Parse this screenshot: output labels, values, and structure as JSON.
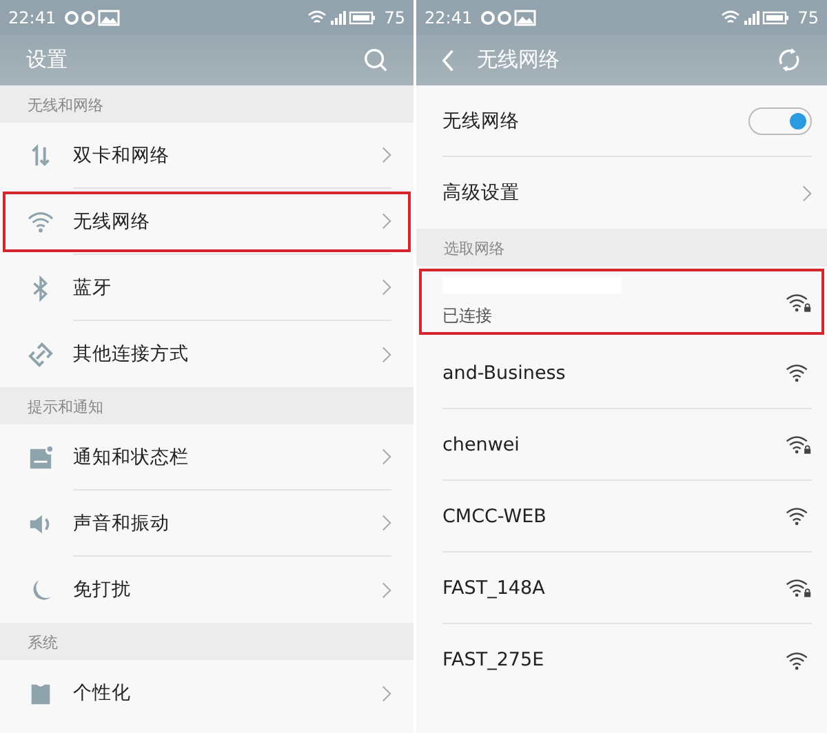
{
  "left_screen": {
    "status_bar": {
      "time": "22:41",
      "battery": "75"
    },
    "title": "设置",
    "sections": [
      {
        "header": "无线和网络",
        "items": [
          {
            "label": "双卡和网络",
            "kind": "sim",
            "highlighted": false
          },
          {
            "label": "无线网络",
            "kind": "wifi",
            "highlighted": true
          },
          {
            "label": "蓝牙",
            "kind": "bluetooth",
            "highlighted": false
          },
          {
            "label": "其他连接方式",
            "kind": "link",
            "highlighted": false
          }
        ]
      },
      {
        "header": "提示和通知",
        "items": [
          {
            "label": "通知和状态栏",
            "kind": "notification",
            "highlighted": false
          },
          {
            "label": "声音和振动",
            "kind": "sound",
            "highlighted": false
          },
          {
            "label": "免打扰",
            "kind": "moon",
            "highlighted": false
          }
        ]
      },
      {
        "header": "系统",
        "items": [
          {
            "label": "个性化",
            "kind": "shirt",
            "highlighted": false
          }
        ]
      }
    ]
  },
  "right_screen": {
    "status_bar": {
      "time": "22:41",
      "battery": "75"
    },
    "title": "无线网络",
    "wifi_toggle": {
      "label": "无线网络",
      "on": true
    },
    "advanced": {
      "label": "高级设置"
    },
    "section_header": "选取网络",
    "networks": [
      {
        "status": "已连接",
        "secured": true,
        "highlighted": true,
        "redacted": true
      },
      {
        "name": "and-Business",
        "secured": false,
        "highlighted": false
      },
      {
        "name": "chenwei",
        "secured": true,
        "highlighted": false
      },
      {
        "name": "CMCC-WEB",
        "secured": false,
        "highlighted": false
      },
      {
        "name": "FAST_148A",
        "secured": true,
        "highlighted": false
      },
      {
        "name": "FAST_275E",
        "secured": false,
        "highlighted": false
      }
    ]
  }
}
